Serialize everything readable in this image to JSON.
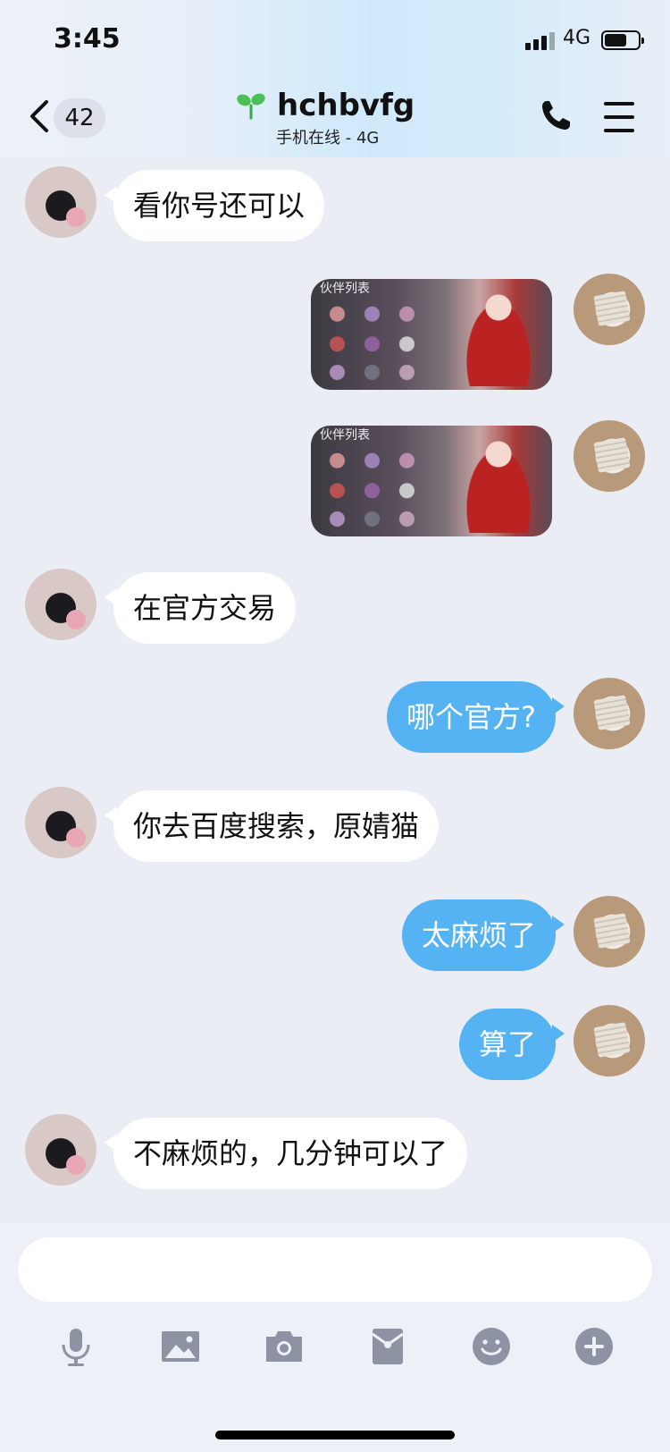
{
  "status_bar": {
    "time": "3:45",
    "network": "4G"
  },
  "header": {
    "back_icon": "chevron-left-icon",
    "unread_count": "42",
    "contact_name": "hchbvfg",
    "presence": "手机在线 - 4G",
    "call_icon": "phone-icon",
    "menu_icon": "hamburger-icon"
  },
  "messages": [
    {
      "from": "other",
      "type": "text",
      "text": "看你号还可以"
    },
    {
      "from": "me",
      "type": "image",
      "caption": "伙伴列表"
    },
    {
      "from": "me",
      "type": "image",
      "caption": "伙伴列表"
    },
    {
      "from": "other",
      "type": "text",
      "text": "在官方交易"
    },
    {
      "from": "me",
      "type": "text",
      "text": "哪个官方?"
    },
    {
      "from": "other",
      "type": "text",
      "text": "你去百度搜索，原婧猫"
    },
    {
      "from": "me",
      "type": "text",
      "text": "太麻烦了"
    },
    {
      "from": "me",
      "type": "text",
      "text": "算了"
    },
    {
      "from": "other",
      "type": "text",
      "text": "不麻烦的，几分钟可以了"
    }
  ],
  "composer": {
    "input_value": "",
    "tools": [
      "microphone-icon",
      "image-icon",
      "camera-icon",
      "red-packet-icon",
      "emoji-icon",
      "plus-icon"
    ]
  },
  "colors": {
    "my_bubble": "#56b3f3",
    "other_bubble": "#ffffff",
    "background": "#ebedf5",
    "icon_gray": "#8e93a3"
  }
}
